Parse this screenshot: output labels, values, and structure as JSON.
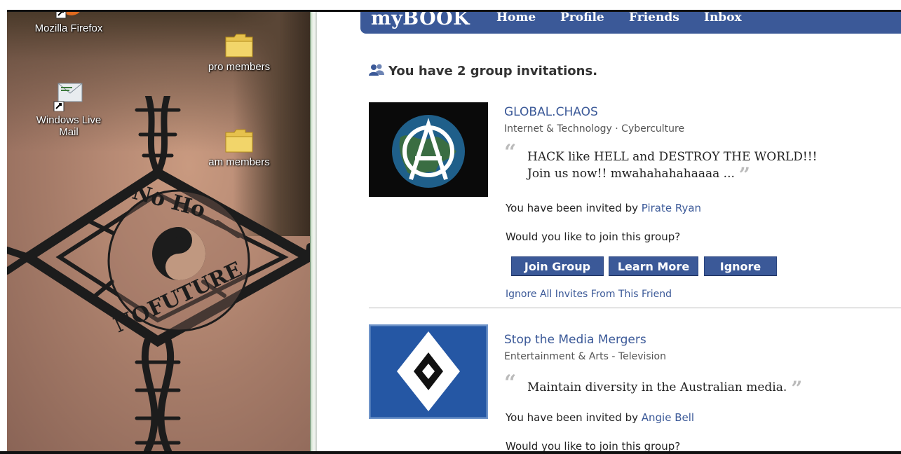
{
  "desktop": {
    "icons": [
      {
        "label": "Mozilla Firefox"
      },
      {
        "label": "Windows Live Mail"
      },
      {
        "label": "pro members"
      },
      {
        "label": "am members"
      }
    ],
    "tattoo_text": {
      "top": "No Ho",
      "bottom": "NOFUTURE"
    }
  },
  "site": {
    "logo": "myBOOK",
    "nav": [
      "Home",
      "Profile",
      "Friends",
      "Inbox"
    ],
    "accent_color": "#3b5998"
  },
  "invitations": {
    "heading": "You have 2 group invitations.",
    "groups": [
      {
        "name": "GLOBAL.CHAOS",
        "category": "Internet & Technology · Cyberculture",
        "quote_line1": "HACK like HELL and DESTROY THE WORLD!!!",
        "quote_line2": "Join us now!!  mwahahahahaaaa ...",
        "invited_prefix": "You have been invited by ",
        "inviter": "Pirate Ryan",
        "question": "Would you like to join this group?",
        "buttons": {
          "join": "Join Group",
          "learn": "Learn More",
          "ignore": "Ignore"
        },
        "ignore_all": "Ignore All Invites From This Friend"
      },
      {
        "name": "Stop the Media Mergers",
        "category": "Entertainment & Arts - Television",
        "quote_line1": "Maintain diversity in the Australian media.",
        "invited_prefix": "You have been invited by ",
        "inviter": "Angie Bell",
        "question": "Would you like to join this group?"
      }
    ]
  }
}
